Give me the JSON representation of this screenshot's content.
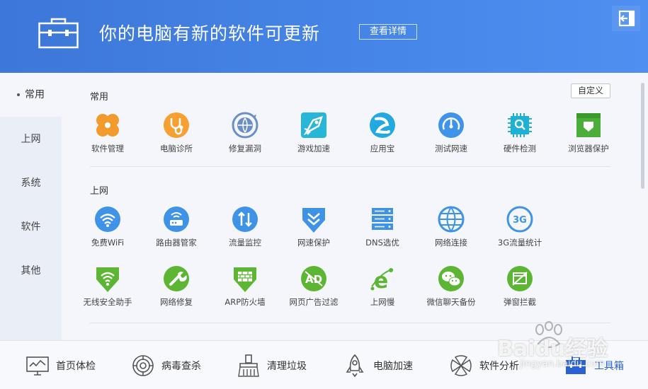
{
  "header": {
    "title": "你的电脑有新的软件可更新",
    "detail_button": "查看详情"
  },
  "sidebar": {
    "items": [
      {
        "label": "常用",
        "active": true
      },
      {
        "label": "上网",
        "active": false
      },
      {
        "label": "系统",
        "active": false
      },
      {
        "label": "软件",
        "active": false
      },
      {
        "label": "其他",
        "active": false
      }
    ]
  },
  "main": {
    "custom_button": "自定义",
    "sections": [
      {
        "title": "常用",
        "tools": [
          {
            "label": "软件管理",
            "icon": "clover-icon",
            "color": "#f39a2c"
          },
          {
            "label": "电脑诊所",
            "icon": "stethoscope-icon",
            "color": "#f5a030"
          },
          {
            "label": "修复漏洞",
            "icon": "globe-repair-icon",
            "color": "#6a8fc6"
          },
          {
            "label": "游戏加速",
            "icon": "game-boost-icon",
            "color": "#28b6d8"
          },
          {
            "label": "应用宝",
            "icon": "app-store-icon",
            "color": "#24a8e0"
          },
          {
            "label": "测试网速",
            "icon": "speed-gauge-icon",
            "color": "#3f93e8"
          },
          {
            "label": "硬件检测",
            "icon": "chip-icon",
            "color": "#1fb0d6"
          },
          {
            "label": "浏览器保护",
            "icon": "browser-shield-icon",
            "color": "#4cae3a"
          }
        ]
      },
      {
        "title": "上网",
        "tools": [
          {
            "label": "免费WiFi",
            "icon": "wifi-icon",
            "color": "#3e93e6"
          },
          {
            "label": "路由器管家",
            "icon": "router-icon",
            "color": "#3e93e6"
          },
          {
            "label": "流量监控",
            "icon": "traffic-arrows-icon",
            "color": "#3e93e6"
          },
          {
            "label": "网速保护",
            "icon": "speed-shield-icon",
            "color": "#3e93e6"
          },
          {
            "label": "DNS选优",
            "icon": "dns-server-icon",
            "color": "#3e93e6"
          },
          {
            "label": "网络连接",
            "icon": "network-globe-icon",
            "color": "#3e93e6"
          },
          {
            "label": "3G流量统计",
            "icon": "3g-icon",
            "color": "#3e93e6"
          },
          {
            "label": "无线安全助手",
            "icon": "wifi-shield-icon",
            "color": "#5cb633"
          },
          {
            "label": "网络修复",
            "icon": "wrench-icon",
            "color": "#5cb633"
          },
          {
            "label": "ARP防火墙",
            "icon": "firewall-icon",
            "color": "#5cb633"
          },
          {
            "label": "网页广告过滤",
            "icon": "ad-block-icon",
            "color": "#5cb633"
          },
          {
            "label": "上网慢",
            "icon": "ie-slow-icon",
            "color": "#5cb633"
          },
          {
            "label": "微信聊天备份",
            "icon": "wechat-icon",
            "color": "#5cb633"
          },
          {
            "label": "弹窗拦截",
            "icon": "popup-block-icon",
            "color": "#5cb633"
          }
        ]
      }
    ]
  },
  "bottom_nav": [
    {
      "label": "首页体检",
      "icon": "monitor-check-icon",
      "active": false
    },
    {
      "label": "病毒查杀",
      "icon": "virus-scan-icon",
      "active": false
    },
    {
      "label": "清理垃圾",
      "icon": "broom-icon",
      "active": false
    },
    {
      "label": "电脑加速",
      "icon": "rocket-icon",
      "active": false
    },
    {
      "label": "软件分析",
      "icon": "software-icon",
      "active": false
    },
    {
      "label": "工具箱",
      "icon": "toolbox-icon",
      "active": true
    }
  ],
  "watermark": {
    "text": "Baidu经验",
    "sub": "jingyan.baidu.com"
  }
}
